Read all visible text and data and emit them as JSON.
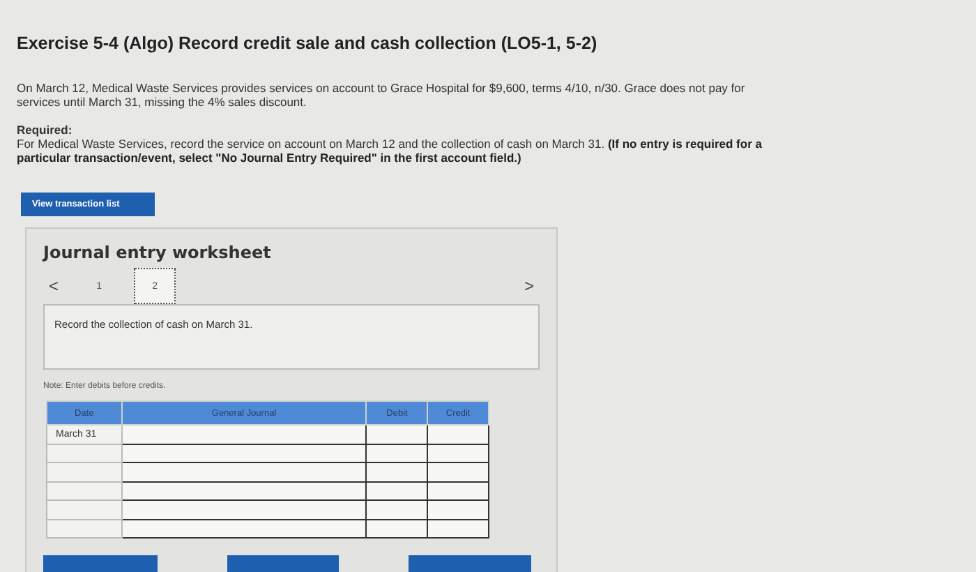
{
  "title": "Exercise 5-4 (Algo) Record credit sale and cash collection (LO5-1, 5-2)",
  "scenario": "On March 12, Medical Waste Services provides services on account to Grace Hospital for $9,600, terms 4/10, n/30. Grace does not pay for services until March 31, missing the 4% sales discount.",
  "required": {
    "heading": "Required:",
    "text": "For Medical Waste Services, record the service on account on March 12 and the collection of cash on March 31. **(If no entry is required for a particular transaction/event, select \"No Journal Entry Required\" in the first account field.)**"
  },
  "view_button": "View transaction list",
  "worksheet": {
    "title": "Journal entry worksheet",
    "prev": "<",
    "next": ">",
    "tabs": [
      {
        "label": "1",
        "selected": false
      },
      {
        "label": "2",
        "selected": true
      }
    ],
    "instruction": "Record the collection of cash on March 31.",
    "note": "Note: Enter debits before credits.",
    "table": {
      "columns": [
        "Date",
        "General Journal",
        "Debit",
        "Credit"
      ],
      "rows": [
        {
          "date": "March 31"
        },
        {},
        {},
        {},
        {},
        {}
      ]
    }
  }
}
